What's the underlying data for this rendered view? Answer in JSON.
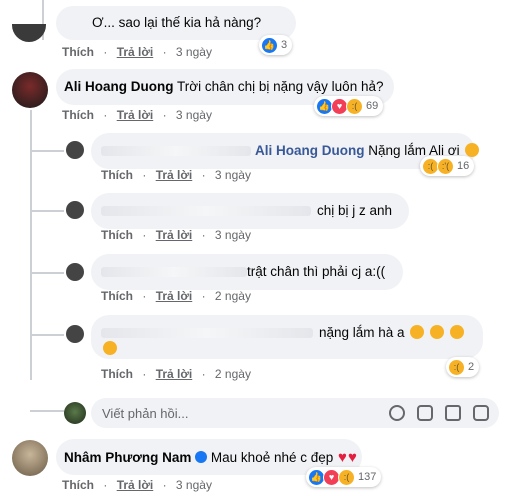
{
  "comments": [
    {
      "author": "",
      "text": "Ơ... sao lại thế kia hả nàng?",
      "like": "Thích",
      "reply": "Trả lời",
      "time": "3 ngày",
      "reactions": "3"
    },
    {
      "author": "Ali Hoang Duong",
      "text": "Trời chân chị bị nặng vậy luôn hả?",
      "like": "Thích",
      "reply": "Trả lời",
      "time": "3 ngày",
      "reactions": "69"
    },
    {
      "author": "",
      "mention": "Ali Hoang Duong",
      "text": "Nặng lắm Ali ơi",
      "like": "Thích",
      "reply": "Trả lời",
      "time": "3 ngày",
      "reactions": "16"
    },
    {
      "author": "",
      "text": "chị bị j z anh",
      "like": "Thích",
      "reply": "Trả lời",
      "time": "3 ngày"
    },
    {
      "author": "",
      "text": "trật chân thì phải cj a:((",
      "like": "Thích",
      "reply": "Trả lời",
      "time": "2 ngày"
    },
    {
      "author": "",
      "text": "nặng lắm hà a",
      "like": "Thích",
      "reply": "Trả lời",
      "time": "2 ngày",
      "reactions": "2"
    },
    {
      "author": "Nhâm Phương Nam",
      "text": "Mau khoẻ nhé c đẹp",
      "like": "Thích",
      "reply": "Trả lời",
      "time": "3 ngày",
      "reactions": "137"
    }
  ],
  "reply_input": {
    "placeholder": "Viết phản hồi..."
  },
  "colors": {
    "like": "#1877f2",
    "love": "#f33e58",
    "sad": "#f7b125",
    "bubble": "#f0f2f5",
    "meta": "#65676b"
  },
  "icons": [
    "like-icon",
    "love-icon",
    "sad-icon",
    "emoji-icon",
    "camera-icon",
    "gif-icon",
    "sticker-icon",
    "verified-icon",
    "heart-emoji"
  ]
}
